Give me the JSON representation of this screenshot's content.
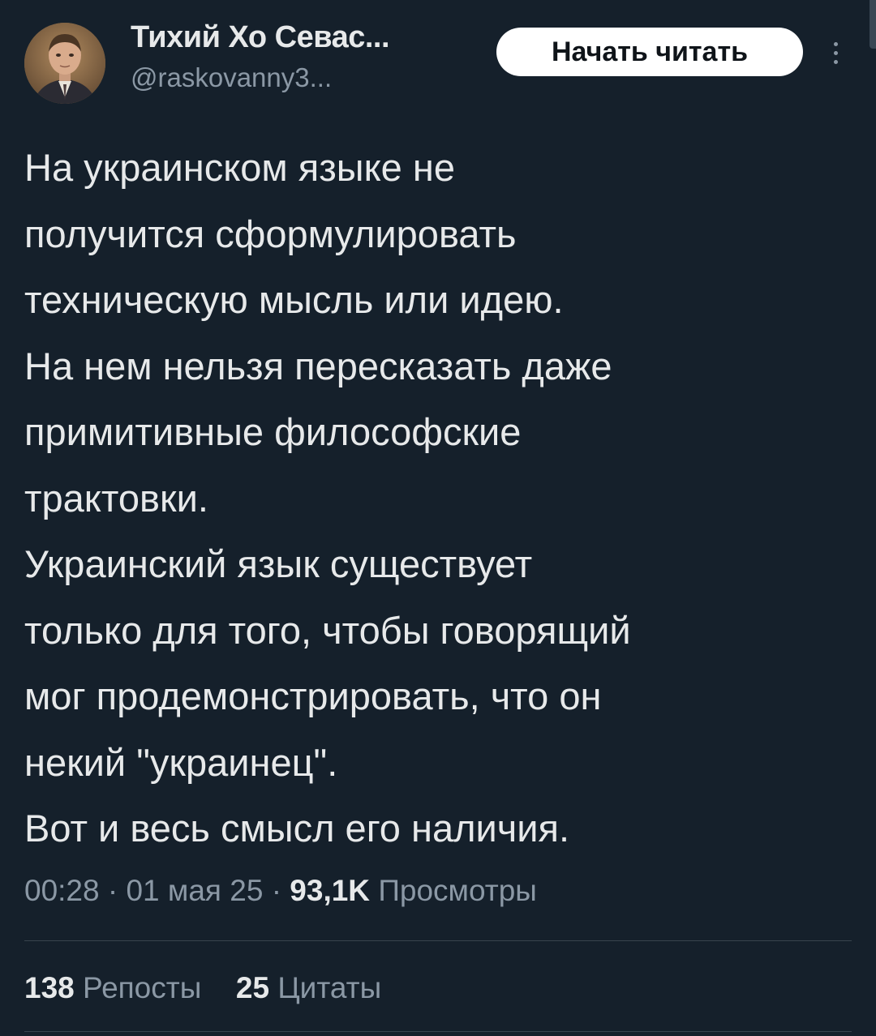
{
  "author": {
    "display_name": "Тихий Хо Севас...",
    "handle": "@raskovanny3..."
  },
  "header": {
    "subscribe_label": "Начать читать",
    "more_icon": "more-vertical-icon"
  },
  "tweet": {
    "lines": [
      "На украинском языке не",
      "получится сформулировать",
      "техническую мысль или идею.",
      "На нем нельзя пересказать даже",
      "примитивные философские",
      "трактовки.",
      "Украинский язык существует",
      "только для того, чтобы говорящий",
      "мог продемонстрировать, что он",
      "некий \"украинец\".",
      "Вот и весь смысл его наличия."
    ]
  },
  "meta": {
    "time": "00:28",
    "separator": "·",
    "date": "01 мая 25",
    "views_count": "93,1K",
    "views_label": "Просмотры"
  },
  "stats": {
    "reposts_count": "138",
    "reposts_label": "Репосты",
    "quotes_count": "25",
    "quotes_label": "Цитаты"
  },
  "colors": {
    "background": "#15202b",
    "text_primary": "#e7e9ea",
    "text_secondary": "#8b98a5",
    "divider": "#38444d",
    "button_bg": "#ffffff"
  }
}
